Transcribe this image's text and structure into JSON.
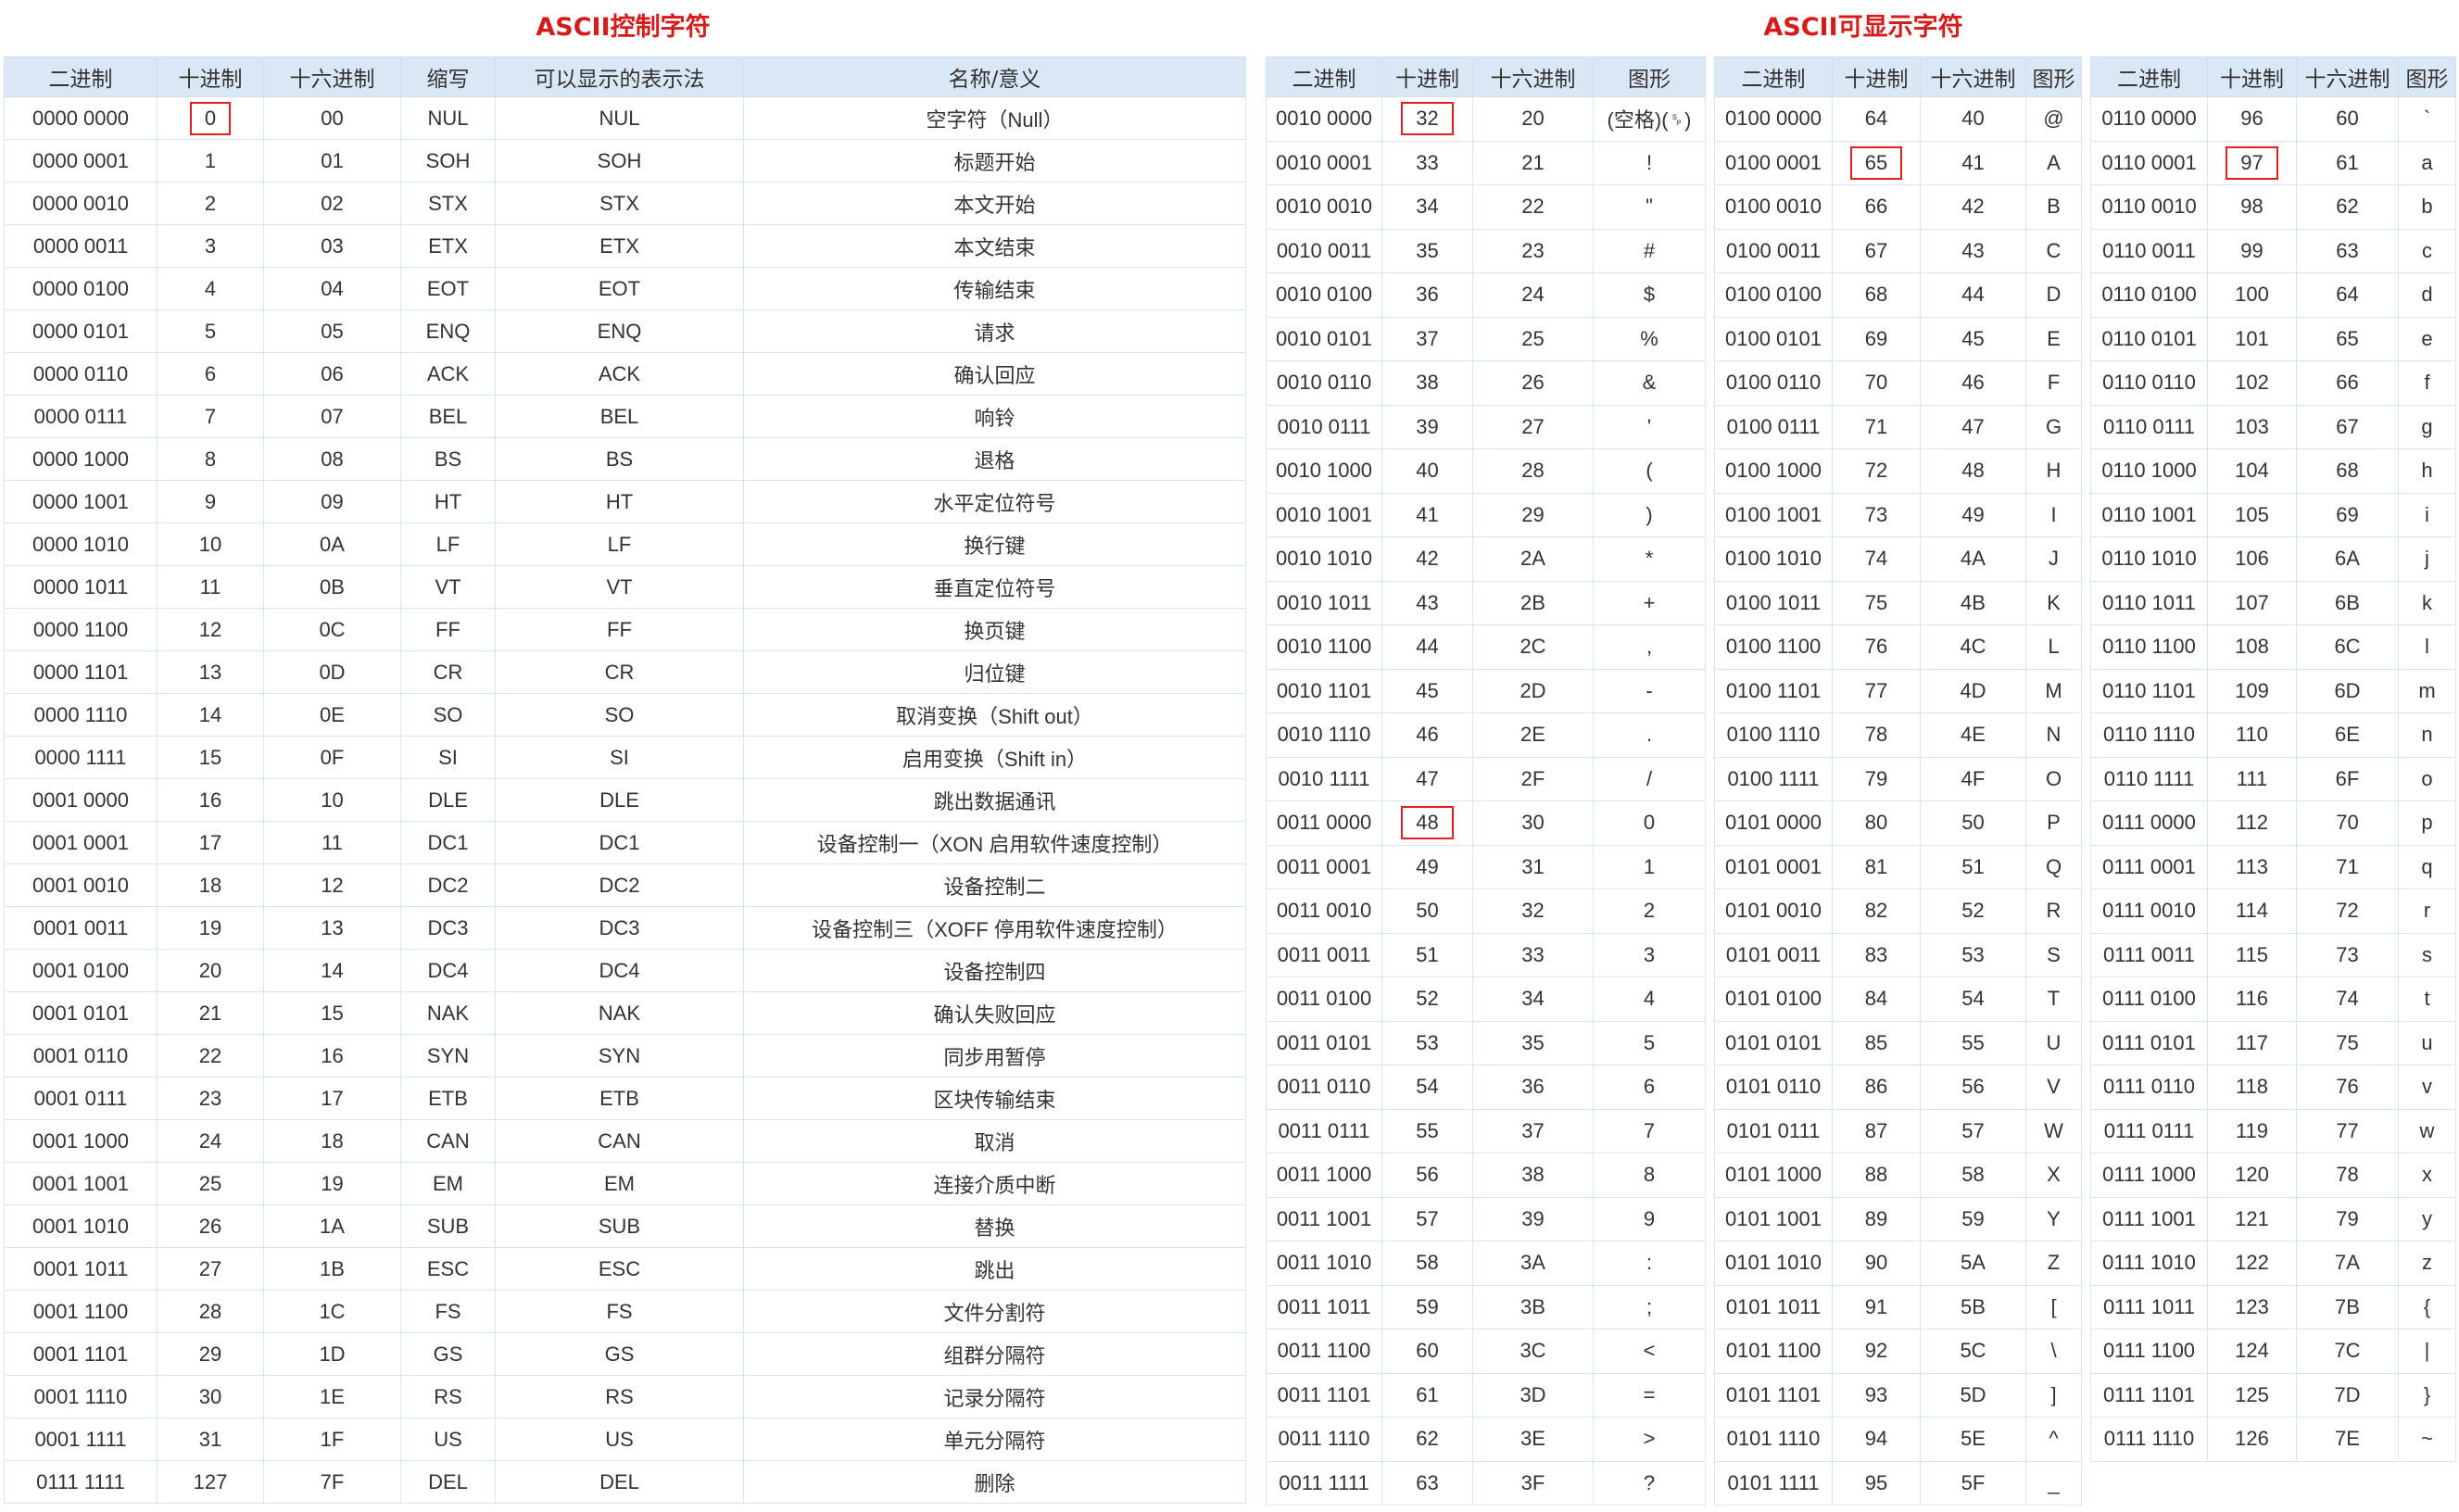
{
  "titles": {
    "control": "ASCII控制字符",
    "printable": "ASCII可显示字符"
  },
  "control_headers": [
    "二进制",
    "十进制",
    "十六进制",
    "缩写",
    "可以显示的表示法",
    "名称/意义"
  ],
  "printable_headers": [
    "二进制",
    "十进制",
    "十六进制",
    "图形"
  ],
  "control_rows": [
    [
      "0000 0000",
      "0",
      "00",
      "NUL",
      "NUL",
      "空字符（Null）"
    ],
    [
      "0000 0001",
      "1",
      "01",
      "SOH",
      "SOH",
      "标题开始"
    ],
    [
      "0000 0010",
      "2",
      "02",
      "STX",
      "STX",
      "本文开始"
    ],
    [
      "0000 0011",
      "3",
      "03",
      "ETX",
      "ETX",
      "本文结束"
    ],
    [
      "0000 0100",
      "4",
      "04",
      "EOT",
      "EOT",
      "传输结束"
    ],
    [
      "0000 0101",
      "5",
      "05",
      "ENQ",
      "ENQ",
      "请求"
    ],
    [
      "0000 0110",
      "6",
      "06",
      "ACK",
      "ACK",
      "确认回应"
    ],
    [
      "0000 0111",
      "7",
      "07",
      "BEL",
      "BEL",
      "响铃"
    ],
    [
      "0000 1000",
      "8",
      "08",
      "BS",
      "BS",
      "退格"
    ],
    [
      "0000 1001",
      "9",
      "09",
      "HT",
      "HT",
      "水平定位符号"
    ],
    [
      "0000 1010",
      "10",
      "0A",
      "LF",
      "LF",
      "换行键"
    ],
    [
      "0000 1011",
      "11",
      "0B",
      "VT",
      "VT",
      "垂直定位符号"
    ],
    [
      "0000 1100",
      "12",
      "0C",
      "FF",
      "FF",
      "换页键"
    ],
    [
      "0000 1101",
      "13",
      "0D",
      "CR",
      "CR",
      "归位键"
    ],
    [
      "0000 1110",
      "14",
      "0E",
      "SO",
      "SO",
      "取消变换（Shift out）"
    ],
    [
      "0000 1111",
      "15",
      "0F",
      "SI",
      "SI",
      "启用变换（Shift in）"
    ],
    [
      "0001 0000",
      "16",
      "10",
      "DLE",
      "DLE",
      "跳出数据通讯"
    ],
    [
      "0001 0001",
      "17",
      "11",
      "DC1",
      "DC1",
      "设备控制一（XON 启用软件速度控制）"
    ],
    [
      "0001 0010",
      "18",
      "12",
      "DC2",
      "DC2",
      "设备控制二"
    ],
    [
      "0001 0011",
      "19",
      "13",
      "DC3",
      "DC3",
      "设备控制三（XOFF 停用软件速度控制）"
    ],
    [
      "0001 0100",
      "20",
      "14",
      "DC4",
      "DC4",
      "设备控制四"
    ],
    [
      "0001 0101",
      "21",
      "15",
      "NAK",
      "NAK",
      "确认失败回应"
    ],
    [
      "0001 0110",
      "22",
      "16",
      "SYN",
      "SYN",
      "同步用暂停"
    ],
    [
      "0001 0111",
      "23",
      "17",
      "ETB",
      "ETB",
      "区块传输结束"
    ],
    [
      "0001 1000",
      "24",
      "18",
      "CAN",
      "CAN",
      "取消"
    ],
    [
      "0001 1001",
      "25",
      "19",
      "EM",
      "EM",
      "连接介质中断"
    ],
    [
      "0001 1010",
      "26",
      "1A",
      "SUB",
      "SUB",
      "替换"
    ],
    [
      "0001 1011",
      "27",
      "1B",
      "ESC",
      "ESC",
      "跳出"
    ],
    [
      "0001 1100",
      "28",
      "1C",
      "FS",
      "FS",
      "文件分割符"
    ],
    [
      "0001 1101",
      "29",
      "1D",
      "GS",
      "GS",
      "组群分隔符"
    ],
    [
      "0001 1110",
      "30",
      "1E",
      "RS",
      "RS",
      "记录分隔符"
    ],
    [
      "0001 1111",
      "31",
      "1F",
      "US",
      "US",
      "单元分隔符"
    ],
    [
      "0111 1111",
      "127",
      "7F",
      "DEL",
      "DEL",
      "删除"
    ]
  ],
  "printable_tables": [
    {
      "highlight": [
        "32",
        "48"
      ],
      "rows": [
        [
          "0010 0000",
          "32",
          "20",
          "(空格)(␠)"
        ],
        [
          "0010 0001",
          "33",
          "21",
          "!"
        ],
        [
          "0010 0010",
          "34",
          "22",
          "\""
        ],
        [
          "0010 0011",
          "35",
          "23",
          "#"
        ],
        [
          "0010 0100",
          "36",
          "24",
          "$"
        ],
        [
          "0010 0101",
          "37",
          "25",
          "%"
        ],
        [
          "0010 0110",
          "38",
          "26",
          "&"
        ],
        [
          "0010 0111",
          "39",
          "27",
          "'"
        ],
        [
          "0010 1000",
          "40",
          "28",
          "("
        ],
        [
          "0010 1001",
          "41",
          "29",
          ")"
        ],
        [
          "0010 1010",
          "42",
          "2A",
          "*"
        ],
        [
          "0010 1011",
          "43",
          "2B",
          "+"
        ],
        [
          "0010 1100",
          "44",
          "2C",
          ","
        ],
        [
          "0010 1101",
          "45",
          "2D",
          "-"
        ],
        [
          "0010 1110",
          "46",
          "2E",
          "."
        ],
        [
          "0010 1111",
          "47",
          "2F",
          "/"
        ],
        [
          "0011 0000",
          "48",
          "30",
          "0"
        ],
        [
          "0011 0001",
          "49",
          "31",
          "1"
        ],
        [
          "0011 0010",
          "50",
          "32",
          "2"
        ],
        [
          "0011 0011",
          "51",
          "33",
          "3"
        ],
        [
          "0011 0100",
          "52",
          "34",
          "4"
        ],
        [
          "0011 0101",
          "53",
          "35",
          "5"
        ],
        [
          "0011 0110",
          "54",
          "36",
          "6"
        ],
        [
          "0011 0111",
          "55",
          "37",
          "7"
        ],
        [
          "0011 1000",
          "56",
          "38",
          "8"
        ],
        [
          "0011 1001",
          "57",
          "39",
          "9"
        ],
        [
          "0011 1010",
          "58",
          "3A",
          ":"
        ],
        [
          "0011 1011",
          "59",
          "3B",
          ";"
        ],
        [
          "0011 1100",
          "60",
          "3C",
          "<"
        ],
        [
          "0011 1101",
          "61",
          "3D",
          "="
        ],
        [
          "0011 1110",
          "62",
          "3E",
          ">"
        ],
        [
          "0011 1111",
          "63",
          "3F",
          "?"
        ]
      ]
    },
    {
      "highlight": [
        "65"
      ],
      "rows": [
        [
          "0100 0000",
          "64",
          "40",
          "@"
        ],
        [
          "0100 0001",
          "65",
          "41",
          "A"
        ],
        [
          "0100 0010",
          "66",
          "42",
          "B"
        ],
        [
          "0100 0011",
          "67",
          "43",
          "C"
        ],
        [
          "0100 0100",
          "68",
          "44",
          "D"
        ],
        [
          "0100 0101",
          "69",
          "45",
          "E"
        ],
        [
          "0100 0110",
          "70",
          "46",
          "F"
        ],
        [
          "0100 0111",
          "71",
          "47",
          "G"
        ],
        [
          "0100 1000",
          "72",
          "48",
          "H"
        ],
        [
          "0100 1001",
          "73",
          "49",
          "I"
        ],
        [
          "0100 1010",
          "74",
          "4A",
          "J"
        ],
        [
          "0100 1011",
          "75",
          "4B",
          "K"
        ],
        [
          "0100 1100",
          "76",
          "4C",
          "L"
        ],
        [
          "0100 1101",
          "77",
          "4D",
          "M"
        ],
        [
          "0100 1110",
          "78",
          "4E",
          "N"
        ],
        [
          "0100 1111",
          "79",
          "4F",
          "O"
        ],
        [
          "0101 0000",
          "80",
          "50",
          "P"
        ],
        [
          "0101 0001",
          "81",
          "51",
          "Q"
        ],
        [
          "0101 0010",
          "82",
          "52",
          "R"
        ],
        [
          "0101 0011",
          "83",
          "53",
          "S"
        ],
        [
          "0101 0100",
          "84",
          "54",
          "T"
        ],
        [
          "0101 0101",
          "85",
          "55",
          "U"
        ],
        [
          "0101 0110",
          "86",
          "56",
          "V"
        ],
        [
          "0101 0111",
          "87",
          "57",
          "W"
        ],
        [
          "0101 1000",
          "88",
          "58",
          "X"
        ],
        [
          "0101 1001",
          "89",
          "59",
          "Y"
        ],
        [
          "0101 1010",
          "90",
          "5A",
          "Z"
        ],
        [
          "0101 1011",
          "91",
          "5B",
          "["
        ],
        [
          "0101 1100",
          "92",
          "5C",
          "\\"
        ],
        [
          "0101 1101",
          "93",
          "5D",
          "]"
        ],
        [
          "0101 1110",
          "94",
          "5E",
          "^"
        ],
        [
          "0101 1111",
          "95",
          "5F",
          "_"
        ]
      ]
    },
    {
      "highlight": [
        "97"
      ],
      "rows": [
        [
          "0110 0000",
          "96",
          "60",
          "`"
        ],
        [
          "0110 0001",
          "97",
          "61",
          "a"
        ],
        [
          "0110 0010",
          "98",
          "62",
          "b"
        ],
        [
          "0110 0011",
          "99",
          "63",
          "c"
        ],
        [
          "0110 0100",
          "100",
          "64",
          "d"
        ],
        [
          "0110 0101",
          "101",
          "65",
          "e"
        ],
        [
          "0110 0110",
          "102",
          "66",
          "f"
        ],
        [
          "0110 0111",
          "103",
          "67",
          "g"
        ],
        [
          "0110 1000",
          "104",
          "68",
          "h"
        ],
        [
          "0110 1001",
          "105",
          "69",
          "i"
        ],
        [
          "0110 1010",
          "106",
          "6A",
          "j"
        ],
        [
          "0110 1011",
          "107",
          "6B",
          "k"
        ],
        [
          "0110 1100",
          "108",
          "6C",
          "l"
        ],
        [
          "0110 1101",
          "109",
          "6D",
          "m"
        ],
        [
          "0110 1110",
          "110",
          "6E",
          "n"
        ],
        [
          "0110 1111",
          "111",
          "6F",
          "o"
        ],
        [
          "0111 0000",
          "112",
          "70",
          "p"
        ],
        [
          "0111 0001",
          "113",
          "71",
          "q"
        ],
        [
          "0111 0010",
          "114",
          "72",
          "r"
        ],
        [
          "0111 0011",
          "115",
          "73",
          "s"
        ],
        [
          "0111 0100",
          "116",
          "74",
          "t"
        ],
        [
          "0111 0101",
          "117",
          "75",
          "u"
        ],
        [
          "0111 0110",
          "118",
          "76",
          "v"
        ],
        [
          "0111 0111",
          "119",
          "77",
          "w"
        ],
        [
          "0111 1000",
          "120",
          "78",
          "x"
        ],
        [
          "0111 1001",
          "121",
          "79",
          "y"
        ],
        [
          "0111 1010",
          "122",
          "7A",
          "z"
        ],
        [
          "0111 1011",
          "123",
          "7B",
          "{"
        ],
        [
          "0111 1100",
          "124",
          "7C",
          "|"
        ],
        [
          "0111 1101",
          "125",
          "7D",
          "}"
        ],
        [
          "0111 1110",
          "126",
          "7E",
          "~"
        ]
      ]
    }
  ],
  "control_highlight": [
    "0"
  ]
}
